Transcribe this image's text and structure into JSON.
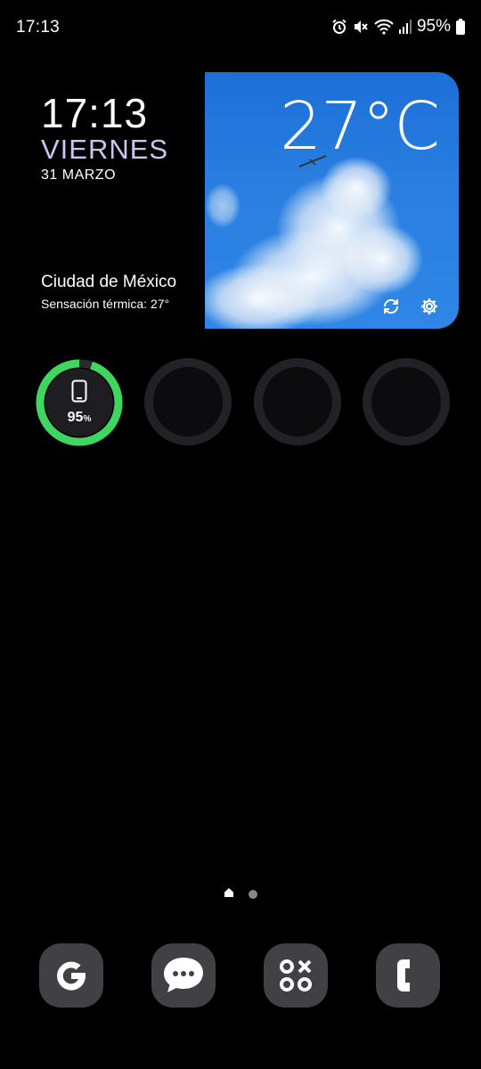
{
  "status_bar": {
    "time": "17:13",
    "battery_percent": "95%",
    "icons": [
      "alarm-icon",
      "mute-icon",
      "wifi-icon",
      "signal-icon",
      "battery-icon"
    ]
  },
  "clock_widget": {
    "time": "17:13",
    "day": "VIERNES",
    "date": "31 MARZO"
  },
  "weather_widget": {
    "city": "Ciudad de México",
    "feels_like": "Sensación térmica: 27°",
    "temperature": "27°C",
    "icons": [
      "refresh-icon",
      "settings-icon"
    ]
  },
  "battery_widget": {
    "value": "95",
    "unit": "%",
    "level": 0.95,
    "ring_color": "#3fd65f"
  },
  "empty_widgets": 3,
  "page_indicator": {
    "pages": [
      "home-icon",
      "dot"
    ]
  },
  "dock": {
    "apps": [
      "google-icon",
      "messages-icon",
      "game-launcher-icon",
      "phone-icon"
    ]
  },
  "colors": {
    "background": "#000000",
    "day_text": "#c9c6ef",
    "dock_icon_bg": "#404045",
    "sky": "#2a7fe0"
  }
}
